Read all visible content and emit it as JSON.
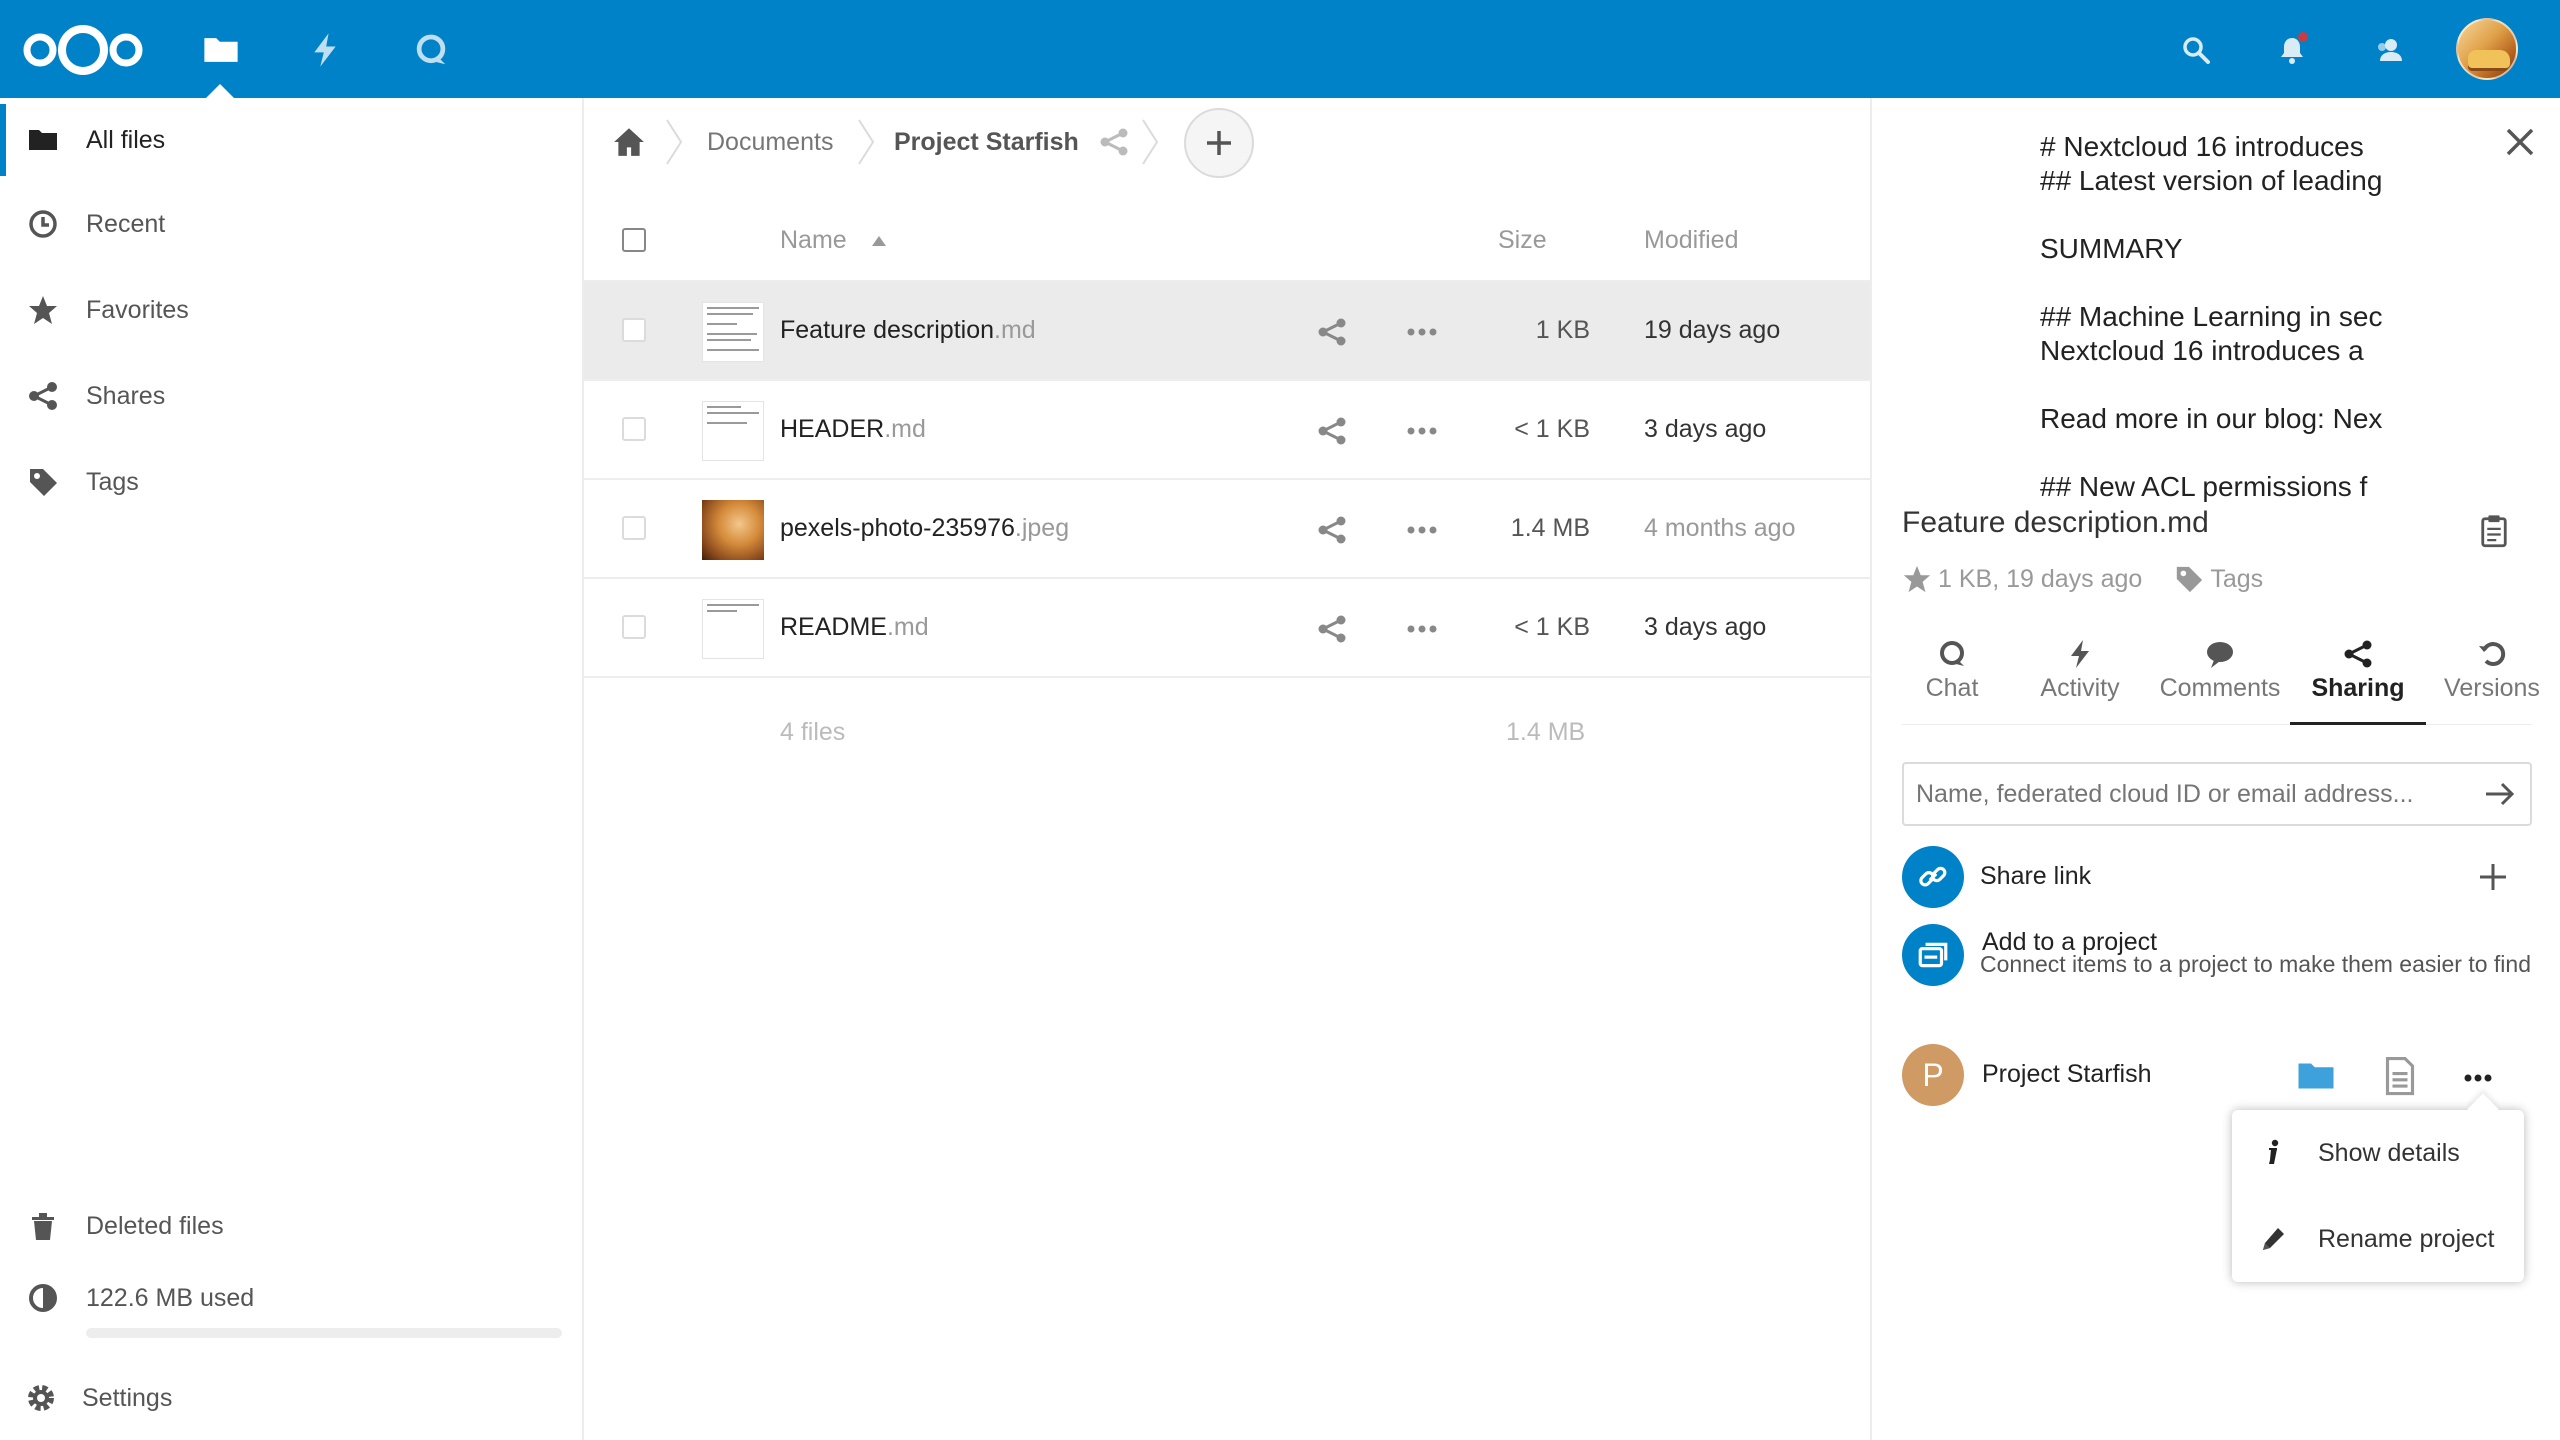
{
  "header": {
    "apps": [
      {
        "name": "Files",
        "icon": "folder-icon"
      },
      {
        "name": "Activity",
        "icon": "lightning-icon"
      },
      {
        "name": "Talk",
        "icon": "talk-icon"
      }
    ],
    "right_icons": [
      "search-icon",
      "bell-icon",
      "contacts-icon",
      "avatar"
    ],
    "brand_color": "#0082c9"
  },
  "navigation": {
    "items": [
      {
        "label": "All files",
        "icon": "folder-icon",
        "active": true
      },
      {
        "label": "Recent",
        "icon": "clock-icon"
      },
      {
        "label": "Favorites",
        "icon": "star-icon"
      },
      {
        "label": "Shares",
        "icon": "share-icon"
      },
      {
        "label": "Tags",
        "icon": "tag-icon"
      }
    ],
    "deleted": "Deleted files",
    "quota": "122.6 MB used",
    "quota_fraction": 0.0,
    "settings": "Settings"
  },
  "breadcrumb": {
    "items": [
      "Documents",
      "Project Starfish"
    ]
  },
  "files": {
    "columns": {
      "name": "Name",
      "size": "Size",
      "modified": "Modified"
    },
    "rows": [
      {
        "name": "Feature description",
        "ext": ".md",
        "size": "1 KB",
        "modified": "19 days ago",
        "selected": true
      },
      {
        "name": "HEADER",
        "ext": ".md",
        "size": "< 1 KB",
        "modified": "3 days ago"
      },
      {
        "name": "pexels-photo-235976",
        "ext": ".jpeg",
        "size": "1.4 MB",
        "modified": "4 months ago"
      },
      {
        "name": "README",
        "ext": ".md",
        "size": "< 1 KB",
        "modified": "3 days ago"
      }
    ],
    "summary_count": "4 files",
    "summary_size": "1.4 MB"
  },
  "sidebar": {
    "preview_lines": [
      "# Nextcloud 16 introduces",
      "## Latest version of leading",
      "",
      "SUMMARY",
      "",
      "## Machine Learning in sec",
      "Nextcloud 16 introduces a",
      "",
      "Read more in our blog: Nex",
      "",
      "## New ACL permissions f"
    ],
    "title": "Feature description.md",
    "meta": "1 KB, 19 days ago",
    "tags_label": "Tags",
    "tabs": [
      {
        "label": "Chat",
        "icon": "talk-icon"
      },
      {
        "label": "Activity",
        "icon": "lightning-icon"
      },
      {
        "label": "Comments",
        "icon": "comment-icon"
      },
      {
        "label": "Sharing",
        "icon": "share-icon",
        "active": true
      },
      {
        "label": "Versions",
        "icon": "history-icon"
      }
    ],
    "share_placeholder": "Name, federated cloud ID or email address...",
    "share_link": "Share link",
    "add_project": "Add to a project",
    "add_project_desc": "Connect items to a project to make them easier to find",
    "project": {
      "initial": "P",
      "name": "Project Starfish"
    },
    "popover": {
      "show_details": "Show details",
      "rename": "Rename project"
    }
  }
}
